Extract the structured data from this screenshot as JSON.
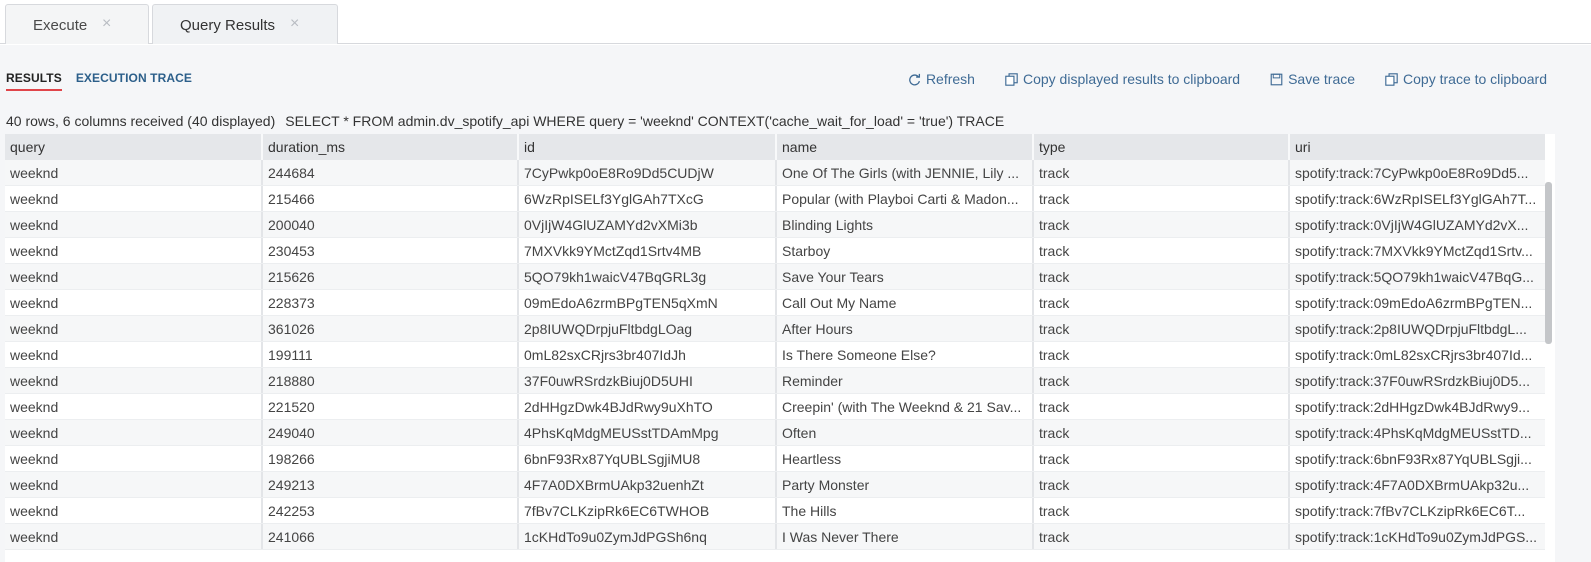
{
  "tabs": [
    {
      "label": "Execute"
    },
    {
      "label": "Query Results"
    }
  ],
  "tab_close_glyph": "×",
  "subtabs": [
    "RESULTS",
    "EXECUTION TRACE"
  ],
  "actions": [
    {
      "label": "Refresh",
      "icon": "refresh-icon"
    },
    {
      "label": "Copy displayed results to clipboard",
      "icon": "copy-icon"
    },
    {
      "label": "Save trace",
      "icon": "save-icon"
    },
    {
      "label": "Copy trace to clipboard",
      "icon": "copy-icon"
    }
  ],
  "summary": {
    "counts": "40 rows, 6 columns received (40 displayed)",
    "sql": "SELECT * FROM admin.dv_spotify_api WHERE query = 'weeknd' CONTEXT('cache_wait_for_load' = 'true') TRACE"
  },
  "table": {
    "columns": [
      "query",
      "duration_ms",
      "id",
      "name",
      "type",
      "uri"
    ],
    "rows": [
      [
        "weeknd",
        "244684",
        "7CyPwkp0oE8Ro9Dd5CUDjW",
        "One Of The Girls (with JENNIE, Lily ...",
        "track",
        "spotify:track:7CyPwkp0oE8Ro9Dd5..."
      ],
      [
        "weeknd",
        "215466",
        "6WzRpISELf3YglGAh7TXcG",
        "Popular (with Playboi Carti & Madon...",
        "track",
        "spotify:track:6WzRpISELf3YglGAh7T..."
      ],
      [
        "weeknd",
        "200040",
        "0VjIjW4GlUZAMYd2vXMi3b",
        "Blinding Lights",
        "track",
        "spotify:track:0VjIjW4GlUZAMYd2vX..."
      ],
      [
        "weeknd",
        "230453",
        "7MXVkk9YMctZqd1Srtv4MB",
        "Starboy",
        "track",
        "spotify:track:7MXVkk9YMctZqd1Srtv..."
      ],
      [
        "weeknd",
        "215626",
        "5QO79kh1waicV47BqGRL3g",
        "Save Your Tears",
        "track",
        "spotify:track:5QO79kh1waicV47BqG..."
      ],
      [
        "weeknd",
        "228373",
        "09mEdoA6zrmBPgTEN5qXmN",
        "Call Out My Name",
        "track",
        "spotify:track:09mEdoA6zrmBPgTEN..."
      ],
      [
        "weeknd",
        "361026",
        "2p8IUWQDrpjuFltbdgLOag",
        "After Hours",
        "track",
        "spotify:track:2p8IUWQDrpjuFltbdgL..."
      ],
      [
        "weeknd",
        "199111",
        "0mL82sxCRjrs3br407IdJh",
        "Is There Someone Else?",
        "track",
        "spotify:track:0mL82sxCRjrs3br407Id..."
      ],
      [
        "weeknd",
        "218880",
        "37F0uwRSrdzkBiuj0D5UHI",
        "Reminder",
        "track",
        "spotify:track:37F0uwRSrdzkBiuj0D5..."
      ],
      [
        "weeknd",
        "221520",
        "2dHHgzDwk4BJdRwy9uXhTO",
        "Creepin' (with The Weeknd & 21 Sav...",
        "track",
        "spotify:track:2dHHgzDwk4BJdRwy9..."
      ],
      [
        "weeknd",
        "249040",
        "4PhsKqMdgMEUSstTDAmMpg",
        "Often",
        "track",
        "spotify:track:4PhsKqMdgMEUSstTD..."
      ],
      [
        "weeknd",
        "198266",
        "6bnF93Rx87YqUBLSgjiMU8",
        "Heartless",
        "track",
        "spotify:track:6bnF93Rx87YqUBLSgji..."
      ],
      [
        "weeknd",
        "249213",
        "4F7A0DXBrmUAkp32uenhZt",
        "Party Monster",
        "track",
        "spotify:track:4F7A0DXBrmUAkp32u..."
      ],
      [
        "weeknd",
        "242253",
        "7fBv7CLKzipRk6EC6TWHOB",
        "The Hills",
        "track",
        "spotify:track:7fBv7CLKzipRk6EC6T..."
      ],
      [
        "weeknd",
        "241066",
        "1cKHdTo9u0ZymJdPGSh6nq",
        "I Was Never There",
        "track",
        "spotify:track:1cKHdTo9u0ZymJdPGS..."
      ]
    ]
  },
  "colors": {
    "accent_red": "#e0454a",
    "link_blue": "#3f6b95",
    "header_bg": "#e5e7ea"
  }
}
